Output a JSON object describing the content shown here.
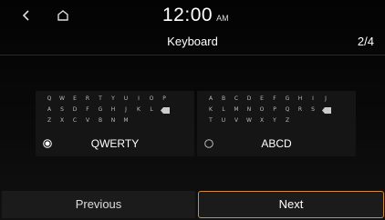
{
  "status": {
    "time": "12:00",
    "ampm": "AM"
  },
  "header": {
    "title": "Keyboard",
    "page_indicator": "2/4"
  },
  "options": [
    {
      "label": "QWERTY",
      "selected": true,
      "rows": [
        [
          "Q",
          "W",
          "E",
          "R",
          "T",
          "Y",
          "U",
          "I",
          "O",
          "P"
        ],
        [
          "A",
          "S",
          "D",
          "F",
          "G",
          "H",
          "J",
          "K",
          "L"
        ],
        [
          "Z",
          "X",
          "C",
          "V",
          "B",
          "N",
          "M"
        ]
      ]
    },
    {
      "label": "ABCD",
      "selected": false,
      "rows": [
        [
          "A",
          "B",
          "C",
          "D",
          "E",
          "F",
          "G",
          "H",
          "I",
          "J"
        ],
        [
          "K",
          "L",
          "M",
          "N",
          "O",
          "P",
          "Q",
          "R",
          "S"
        ],
        [
          "T",
          "U",
          "V",
          "W",
          "X",
          "Y",
          "Z"
        ]
      ]
    }
  ],
  "footer": {
    "previous_label": "Previous",
    "next_label": "Next"
  },
  "colors": {
    "accent": "#d38a3a",
    "background": "#000000"
  }
}
